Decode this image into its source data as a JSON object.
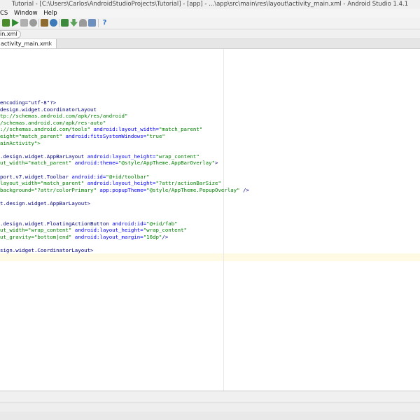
{
  "window": {
    "title": "Tutorial - [C:\\Users\\Carlos\\AndroidStudioProjects\\Tutorial] - [app] - ...\\app\\src\\main\\res\\layout\\activity_main.xml - Android Studio 1.4.1"
  },
  "menu": {
    "items": [
      "CS",
      "Window",
      "Help"
    ]
  },
  "toolbar": {
    "buttons": [
      {
        "icon": "build-icon",
        "color": "#4a8c2a"
      },
      {
        "icon": "run-icon",
        "color": "#2e8b2e"
      },
      {
        "icon": "stop-icon",
        "color": "#b0b0b0"
      },
      {
        "icon": "attach-icon",
        "color": "#9a9a9a"
      },
      {
        "icon": "sdk-manager-icon",
        "color": "#8e6b2e"
      },
      {
        "icon": "sync-icon",
        "color": "#3d7ab8"
      },
      {
        "icon": "avd-icon",
        "color": "#3b8a3b"
      },
      {
        "icon": "download-icon",
        "color": "#5ba35b"
      },
      {
        "icon": "android-icon",
        "color": "#9a9a9a"
      },
      {
        "icon": "monitor-icon",
        "color": "#6c8fbf"
      },
      {
        "icon": "help-icon",
        "color": "#2d6fbf"
      }
    ]
  },
  "navbar": {
    "crumb": "in.xml"
  },
  "tabs": [
    {
      "label": "activity_main.xml",
      "close": "×"
    }
  ],
  "editor": {
    "lines": [
      [
        {
          "t": "encoding=\"utf-8\"?>",
          "c": "t-tag"
        }
      ],
      [
        {
          "t": "design.widget.CoordinatorLayout",
          "c": "t-tag"
        }
      ],
      [
        {
          "t": "tp://schemas.android.com/apk/res/android\"",
          "c": "t-val"
        }
      ],
      [
        {
          "t": "/schemas.android.com/apk/res-auto\"",
          "c": "t-val"
        }
      ],
      [
        {
          "t": "://schemas.android.com/tools\" ",
          "c": "t-val"
        },
        {
          "t": "android:layout_width=",
          "c": "t-attr"
        },
        {
          "t": "\"match_parent\"",
          "c": "t-val"
        }
      ],
      [
        {
          "t": "eight=\"match_parent\" ",
          "c": "t-val"
        },
        {
          "t": "android:fitsSystemWindows=",
          "c": "t-attr"
        },
        {
          "t": "\"true\"",
          "c": "t-val"
        }
      ],
      [
        {
          "t": "ainActivity\">",
          "c": "t-val"
        }
      ],
      [
        {
          "t": "",
          "c": "t-tag"
        }
      ],
      [
        {
          "t": ".design.widget.AppBarLayout ",
          "c": "t-tag"
        },
        {
          "t": "android:layout_height=",
          "c": "t-attr"
        },
        {
          "t": "\"wrap_content\"",
          "c": "t-val"
        }
      ],
      [
        {
          "t": "ut_width=\"match_parent\" ",
          "c": "t-val"
        },
        {
          "t": "android:theme=",
          "c": "t-attr"
        },
        {
          "t": "\"@style/AppTheme.AppBarOverlay\"",
          "c": "t-val"
        },
        {
          "t": ">",
          "c": "t-tag"
        }
      ],
      [
        {
          "t": "",
          "c": "t-tag"
        }
      ],
      [
        {
          "t": "port.v7.widget.Toolbar ",
          "c": "t-tag"
        },
        {
          "t": "android:id=",
          "c": "t-attr"
        },
        {
          "t": "\"@+id/toolbar\"",
          "c": "t-val"
        }
      ],
      [
        {
          "t": "layout_width=\"match_parent\" ",
          "c": "t-val"
        },
        {
          "t": "android:layout_height=",
          "c": "t-attr"
        },
        {
          "t": "\"?attr/actionBarSize\"",
          "c": "t-val"
        }
      ],
      [
        {
          "t": "background=\"?attr/colorPrimary\" ",
          "c": "t-val"
        },
        {
          "t": "app:popupTheme=",
          "c": "t-attr"
        },
        {
          "t": "\"@style/AppTheme.PopupOverlay\"",
          "c": "t-val"
        },
        {
          "t": " />",
          "c": "t-tag"
        }
      ],
      [
        {
          "t": "",
          "c": "t-tag"
        }
      ],
      [
        {
          "t": "t.design.widget.AppBarLayout>",
          "c": "t-tag"
        }
      ],
      [
        {
          "t": "",
          "c": "t-tag"
        }
      ],
      [
        {
          "t": "",
          "c": "t-tag"
        }
      ],
      [
        {
          "t": ".design.widget.FloatingActionButton ",
          "c": "t-tag"
        },
        {
          "t": "android:id=",
          "c": "t-attr"
        },
        {
          "t": "\"@+id/fab\"",
          "c": "t-val"
        }
      ],
      [
        {
          "t": "ut_width=\"wrap_content\" ",
          "c": "t-val"
        },
        {
          "t": "android:layout_height=",
          "c": "t-attr"
        },
        {
          "t": "\"wrap_content\"",
          "c": "t-val"
        }
      ],
      [
        {
          "t": "ut_gravity=\"bottom|end\" ",
          "c": "t-val"
        },
        {
          "t": "android:layout_margin=",
          "c": "t-attr"
        },
        {
          "t": "\"16dp\"",
          "c": "t-val"
        },
        {
          "t": "/>",
          "c": "t-tag"
        }
      ],
      [
        {
          "t": "",
          "c": "t-tag"
        }
      ],
      [
        {
          "t": "sign.widget.CoordinatorLayout>",
          "c": "t-tag"
        }
      ]
    ]
  }
}
